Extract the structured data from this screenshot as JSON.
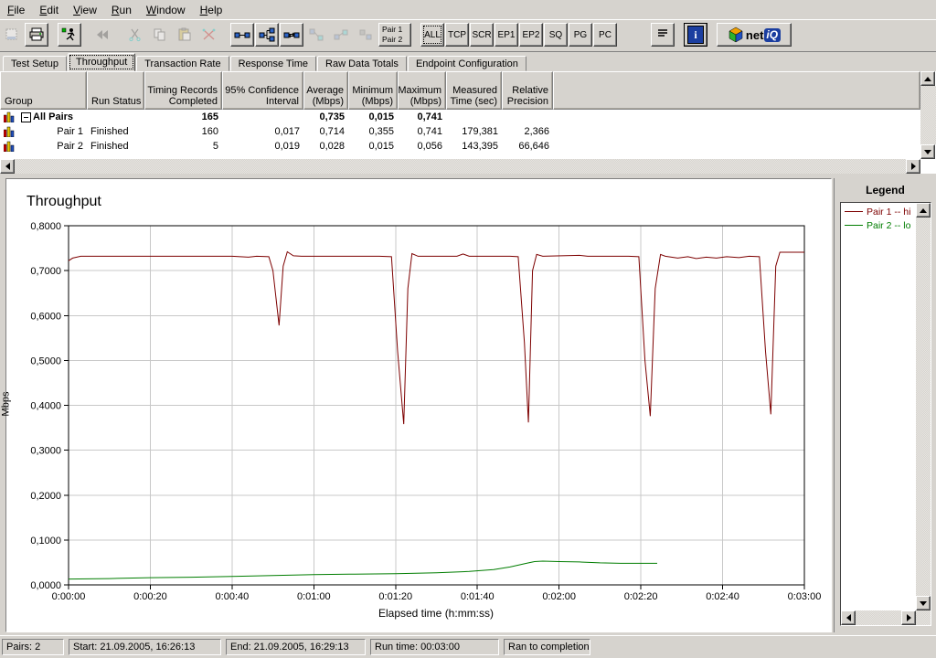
{
  "menubar": {
    "items": [
      "File",
      "Edit",
      "View",
      "Run",
      "Window",
      "Help"
    ]
  },
  "toolbar": {
    "icon_buttons": [
      "new-report-icon",
      "printer-icon",
      "runner-icon",
      "rewind-icon",
      "scissors-icon",
      "copy-icon",
      "paste-icon",
      "delete-x-icon",
      "pair-link-icon",
      "pair-tree-icon",
      "pair-hub-icon",
      "pair-faded-1-icon",
      "pair-faded-2-icon",
      "pair-faded-3-icon",
      "dither-icon",
      "lines-icon",
      "info-icon"
    ],
    "pair_list_button": [
      "Pair 1",
      "Pair 2"
    ],
    "filter_buttons": [
      "ALL",
      "TCP",
      "SCR",
      "EP1",
      "EP2",
      "SQ",
      "PG",
      "PC"
    ],
    "logo": {
      "net": "net",
      "iq": "iQ"
    }
  },
  "tabs": {
    "items": [
      "Test Setup",
      "Throughput",
      "Transaction Rate",
      "Response Time",
      "Raw Data Totals",
      "Endpoint Configuration"
    ],
    "active": "Throughput"
  },
  "table": {
    "columns": [
      {
        "lines": [
          "Group"
        ],
        "align": "left",
        "width": 95
      },
      {
        "lines": [
          "Run Status"
        ],
        "align": "left",
        "width": 63
      },
      {
        "lines": [
          "Timing Records",
          "Completed"
        ],
        "align": "right",
        "width": 85
      },
      {
        "lines": [
          "95% Confidence",
          "Interval"
        ],
        "align": "right",
        "width": 89
      },
      {
        "lines": [
          "Average",
          "(Mbps)"
        ],
        "align": "right",
        "width": 49
      },
      {
        "lines": [
          "Minimum",
          "(Mbps)"
        ],
        "align": "right",
        "width": 54
      },
      {
        "lines": [
          "Maximum",
          "(Mbps)"
        ],
        "align": "right",
        "width": 53
      },
      {
        "lines": [
          "Measured",
          "Time (sec)"
        ],
        "align": "right",
        "width": 61
      },
      {
        "lines": [
          "Relative",
          "Precision"
        ],
        "align": "right",
        "width": 56
      }
    ],
    "rows": [
      {
        "icon": "bar-chart-icon",
        "expander": true,
        "group": "All Pairs",
        "bold": true,
        "run_status": "",
        "values": [
          "165",
          "",
          "0,735",
          "0,015",
          "0,741",
          "",
          ""
        ]
      },
      {
        "icon": "bar-chart-icon",
        "expander": false,
        "group": "Pair 1",
        "bold": false,
        "run_status": "Finished",
        "values": [
          "160",
          "0,017",
          "0,714",
          "0,355",
          "0,741",
          "179,381",
          "2,366"
        ]
      },
      {
        "icon": "bar-chart-icon",
        "expander": false,
        "group": "Pair 2",
        "bold": false,
        "run_status": "Finished",
        "values": [
          "5",
          "0,019",
          "0,028",
          "0,015",
          "0,056",
          "143,395",
          "66,646"
        ]
      }
    ]
  },
  "chart_data": {
    "type": "line",
    "title": "Throughput",
    "xlabel": "Elapsed time (h:mm:ss)",
    "ylabel": "Mbps",
    "xlim": [
      0,
      180
    ],
    "ylim": [
      0,
      0.8
    ],
    "grid": true,
    "legend_position": "right-panel",
    "xticks": {
      "values": [
        0,
        20,
        40,
        60,
        80,
        100,
        120,
        140,
        160,
        180
      ],
      "labels": [
        "0:00:00",
        "0:00:20",
        "0:00:40",
        "0:01:00",
        "0:01:20",
        "0:01:40",
        "0:02:00",
        "0:02:20",
        "0:02:40",
        "0:03:00"
      ]
    },
    "yticks": {
      "values": [
        0,
        0.1,
        0.2,
        0.3,
        0.4,
        0.5,
        0.6,
        0.7,
        0.8
      ],
      "labels": [
        "0,0000",
        "0,1000",
        "0,2000",
        "0,3000",
        "0,4000",
        "0,5000",
        "0,6000",
        "0,7000",
        "0,8000"
      ]
    },
    "series": [
      {
        "name": "Pair 1 -- hi",
        "color": "#7d0000",
        "points": [
          [
            0,
            0.722
          ],
          [
            1,
            0.728
          ],
          [
            3,
            0.732
          ],
          [
            40,
            0.732
          ],
          [
            44,
            0.73
          ],
          [
            46,
            0.732
          ],
          [
            49,
            0.731
          ],
          [
            50,
            0.7
          ],
          [
            51.5,
            0.578
          ],
          [
            52.5,
            0.71
          ],
          [
            53.5,
            0.742
          ],
          [
            55,
            0.733
          ],
          [
            57,
            0.732
          ],
          [
            76,
            0.732
          ],
          [
            79,
            0.731
          ],
          [
            80.5,
            0.52
          ],
          [
            82,
            0.358
          ],
          [
            83,
            0.66
          ],
          [
            84,
            0.738
          ],
          [
            85.5,
            0.732
          ],
          [
            95,
            0.732
          ],
          [
            96.5,
            0.737
          ],
          [
            98,
            0.732
          ],
          [
            108,
            0.732
          ],
          [
            110,
            0.731
          ],
          [
            111.5,
            0.54
          ],
          [
            112.5,
            0.362
          ],
          [
            113.5,
            0.7
          ],
          [
            114.5,
            0.736
          ],
          [
            116,
            0.732
          ],
          [
            125,
            0.734
          ],
          [
            127,
            0.732
          ],
          [
            137,
            0.732
          ],
          [
            139.5,
            0.731
          ],
          [
            141,
            0.5
          ],
          [
            142.3,
            0.376
          ],
          [
            143.5,
            0.66
          ],
          [
            144.8,
            0.736
          ],
          [
            146,
            0.732
          ],
          [
            149,
            0.728
          ],
          [
            151.5,
            0.731
          ],
          [
            153.5,
            0.727
          ],
          [
            156,
            0.73
          ],
          [
            158.5,
            0.728
          ],
          [
            161,
            0.731
          ],
          [
            164,
            0.729
          ],
          [
            166.5,
            0.732
          ],
          [
            169,
            0.731
          ],
          [
            170.5,
            0.52
          ],
          [
            171.8,
            0.38
          ],
          [
            173,
            0.71
          ],
          [
            174,
            0.741
          ],
          [
            180,
            0.741
          ]
        ]
      },
      {
        "name": "Pair 2 -- lo",
        "color": "#007d00",
        "points": [
          [
            0,
            0.013
          ],
          [
            10,
            0.014
          ],
          [
            20,
            0.016
          ],
          [
            30,
            0.017
          ],
          [
            40,
            0.019
          ],
          [
            50,
            0.021
          ],
          [
            60,
            0.023
          ],
          [
            70,
            0.024
          ],
          [
            80,
            0.025
          ],
          [
            90,
            0.027
          ],
          [
            98,
            0.03
          ],
          [
            104,
            0.034
          ],
          [
            108,
            0.04
          ],
          [
            112,
            0.048
          ],
          [
            114,
            0.052
          ],
          [
            116,
            0.053
          ],
          [
            120,
            0.052
          ],
          [
            125,
            0.051
          ],
          [
            130,
            0.049
          ],
          [
            135,
            0.048
          ],
          [
            144,
            0.048
          ]
        ]
      }
    ]
  },
  "legend": {
    "title": "Legend",
    "items": [
      {
        "label": "Pair 1 -- hi",
        "color": "#7d0000"
      },
      {
        "label": "Pair 2 -- lo",
        "color": "#007d00"
      }
    ]
  },
  "statusbar": {
    "sections": [
      "Pairs: 2",
      "Start: 21.09.2005, 16:26:13",
      "End: 21.09.2005, 16:29:13",
      "Run time: 00:03:00",
      "Ran to completion"
    ]
  }
}
